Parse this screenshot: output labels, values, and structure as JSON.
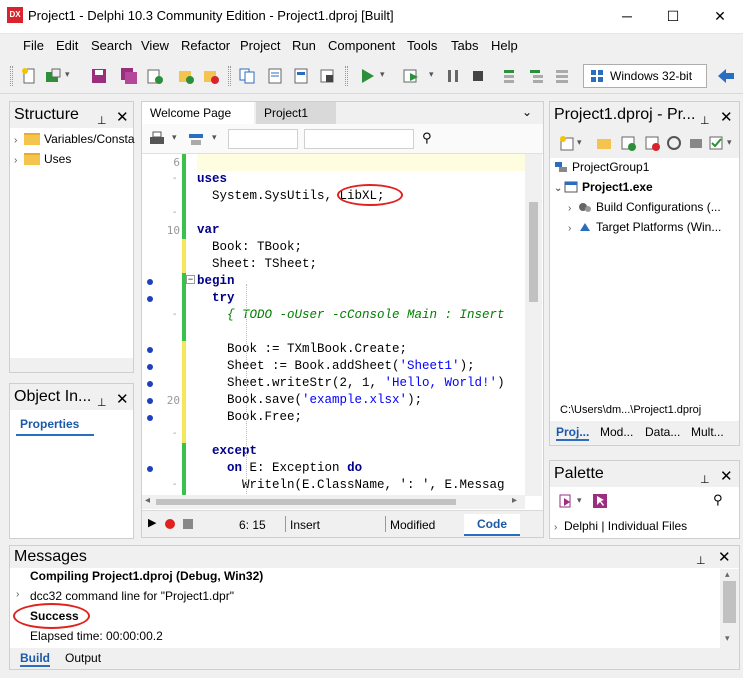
{
  "window": {
    "title": "Project1 - Delphi 10.3 Community Edition - Project1.dproj [Built]",
    "icon_text": "DX",
    "minimize": "─",
    "maximize": "☐",
    "close": "✕"
  },
  "menu": [
    "File",
    "Edit",
    "Search",
    "View",
    "Refactor",
    "Project",
    "Run",
    "Component",
    "Tools",
    "Tabs",
    "Help"
  ],
  "toolbar": {
    "platform": "Windows 32-bit"
  },
  "structure": {
    "title": "Structure",
    "items": [
      "Variables/Consta",
      "Uses"
    ]
  },
  "object_inspector": {
    "title": "Object In...",
    "tab": "Properties"
  },
  "editor": {
    "tabs": [
      "Welcome Page",
      "Project1"
    ],
    "line_numbers": [
      "6",
      "10",
      "20"
    ],
    "code": {
      "l1": "uses",
      "l2a": "  System.SysUtils, ",
      "l2b": "LibXL;",
      "l3": "var",
      "l4": "  Book: TBook;",
      "l5": "  Sheet: TSheet;",
      "l6": "begin",
      "l7": "  try",
      "l8": "    { TODO -oUser -cConsole Main : Insert",
      "l9": "    Book := TXmlBook.Create;",
      "l10a": "    Sheet := Book.addSheet(",
      "l10s": "'Sheet1'",
      "l10b": ");",
      "l11a": "    Sheet.writeStr(2, 1, ",
      "l11s": "'Hello, World!'",
      "l11b": ")",
      "l12a": "    Book.save(",
      "l12s": "'example.xlsx'",
      "l12b": ");",
      "l13": "    Book.Free;",
      "l14": "  except",
      "l15a": "    ",
      "l15k1": "on",
      "l15m": " E: Exception ",
      "l15k2": "do",
      "l16": "      Writeln(E.ClassName, ': ', E.Messag"
    },
    "status": {
      "position": "6: 15",
      "mode": "Insert",
      "modified": "Modified",
      "view_tab": "Code"
    }
  },
  "project": {
    "title": "Project1.dproj - Pr...",
    "tree": [
      "ProjectGroup1",
      "Project1.exe",
      "Build Configurations (...",
      "Target Platforms (Win..."
    ],
    "path": "C:\\Users\\dm...\\Project1.dproj",
    "tabs": [
      "Proj...",
      "Mod...",
      "Data...",
      "Mult..."
    ]
  },
  "palette": {
    "title": "Palette",
    "item": "Delphi | Individual Files"
  },
  "messages": {
    "title": "Messages",
    "lines": [
      "Compiling Project1.dproj (Debug, Win32)",
      "dcc32 command line for \"Project1.dpr\"",
      "Success",
      "Elapsed time: 00:00:00.2"
    ],
    "tabs": [
      "Build",
      "Output"
    ]
  },
  "colors": {
    "accent": "#2b6dbf",
    "highlight_ring": "#e0221f",
    "keyword": "#00008b",
    "string": "#0000ff",
    "comment": "#008000"
  }
}
